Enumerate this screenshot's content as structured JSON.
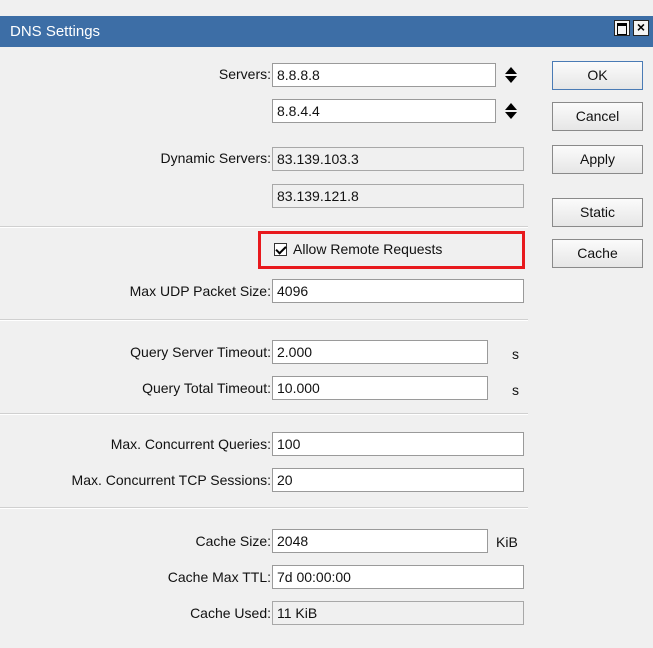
{
  "window": {
    "title": "DNS Settings",
    "maximize_icon": "maximize-icon",
    "close_glyph": "×"
  },
  "form": {
    "servers_label": "Servers:",
    "servers": [
      "8.8.8.8",
      "8.8.4.4"
    ],
    "dynamic_servers_label": "Dynamic Servers:",
    "dynamic_servers": [
      "83.139.103.3",
      "83.139.121.8"
    ],
    "allow_remote_label": "Allow Remote Requests",
    "allow_remote_checked": true,
    "max_udp_label": "Max UDP Packet Size:",
    "max_udp_value": "4096",
    "query_server_timeout_label": "Query Server Timeout:",
    "query_server_timeout_value": "2.000",
    "query_server_timeout_unit": "s",
    "query_total_timeout_label": "Query Total Timeout:",
    "query_total_timeout_value": "10.000",
    "query_total_timeout_unit": "s",
    "max_concurrent_queries_label": "Max. Concurrent Queries:",
    "max_concurrent_queries_value": "100",
    "max_concurrent_tcp_label": "Max. Concurrent TCP Sessions:",
    "max_concurrent_tcp_value": "20",
    "cache_size_label": "Cache Size:",
    "cache_size_value": "2048",
    "cache_size_unit": "KiB",
    "cache_max_ttl_label": "Cache Max TTL:",
    "cache_max_ttl_value": "7d 00:00:00",
    "cache_used_label": "Cache Used:",
    "cache_used_value": "11 KiB"
  },
  "buttons": {
    "ok": "OK",
    "cancel": "Cancel",
    "apply": "Apply",
    "static": "Static",
    "cache": "Cache"
  },
  "colors": {
    "titlebar": "#3d6ea6",
    "highlight": "#e8191d",
    "background": "#f0f0f0"
  }
}
